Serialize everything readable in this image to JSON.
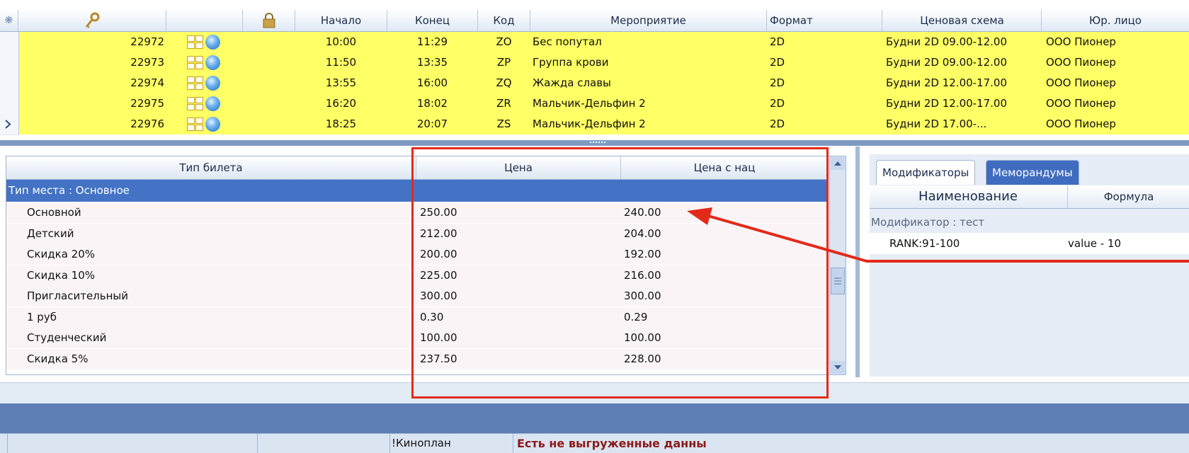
{
  "top_grid": {
    "columns": {
      "Начало": "Начало",
      "Конец": "Конец",
      "Код": "Код",
      "Мероприятие": "Мероприятие",
      "Формат": "Формат",
      "schema": "Ценовая схема",
      "legal": "Юр. лицо"
    },
    "rows": [
      {
        "id": "22972",
        "start": "10:00",
        "end": "11:29",
        "code": "ZO",
        "event": "Бес попутал",
        "format": "2D",
        "schema": "Будни 2D 09.00-12.00",
        "legal": "ООО Пионер"
      },
      {
        "id": "22973",
        "start": "11:50",
        "end": "13:35",
        "code": "ZP",
        "event": "Группа крови",
        "format": "2D",
        "schema": "Будни 2D 09.00-12.00",
        "legal": "ООО Пионер"
      },
      {
        "id": "22974",
        "start": "13:55",
        "end": "16:00",
        "code": "ZQ",
        "event": "Жажда славы",
        "format": "2D",
        "schema": "Будни 2D 12.00-17.00",
        "legal": "ООО Пионер"
      },
      {
        "id": "22975",
        "start": "16:20",
        "end": "18:02",
        "code": "ZR",
        "event": "Мальчик-Дельфин 2",
        "format": "2D",
        "schema": "Будни 2D 12.00-17.00",
        "legal": "ООО Пионер"
      },
      {
        "id": "22976",
        "start": "18:25",
        "end": "20:07",
        "code": "ZS",
        "event": "Мальчик-Дельфин 2",
        "format": "2D",
        "schema": "Будни 2D 17.00-...",
        "legal": "ООО Пионер"
      }
    ]
  },
  "ticket_panel": {
    "columns": {
      "type": "Тип билета",
      "price": "Цена",
      "price_markup": "Цена с нац"
    },
    "group_label": "Тип места : Основное",
    "rows": [
      {
        "type": "Основной",
        "price": "250.00",
        "price_markup": "240.00"
      },
      {
        "type": "Детский",
        "price": "212.00",
        "price_markup": "204.00"
      },
      {
        "type": "Скидка 20%",
        "price": "200.00",
        "price_markup": "192.00"
      },
      {
        "type": "Скидка 10%",
        "price": "225.00",
        "price_markup": "216.00"
      },
      {
        "type": "Пригласительный",
        "price": "300.00",
        "price_markup": "300.00"
      },
      {
        "type": "1 руб",
        "price": "0.30",
        "price_markup": "0.29"
      },
      {
        "type": "Студенческий",
        "price": "100.00",
        "price_markup": "100.00"
      },
      {
        "type": "Скидка 5%",
        "price": "237.50",
        "price_markup": "228.00"
      }
    ]
  },
  "right_panel": {
    "tabs": [
      "Модификаторы",
      "Меморандумы"
    ],
    "columns": {
      "name": "Наименование",
      "formula": "Формула"
    },
    "group_label": "Модификатор : тест",
    "rows": [
      {
        "name": "RANK:91-100",
        "formula": "value - 10"
      }
    ]
  },
  "status_bar": {
    "app": "!Киноплан",
    "message": "Есть не выгруженные данны"
  },
  "icons": {
    "settings": "asterisk-icon",
    "key": "key-icon",
    "lock": "lock-icon",
    "grid": "grid-icon",
    "globe": "globe-icon",
    "current_row": "row-pointer-icon"
  },
  "colors": {
    "row_highlight": "#ffff66",
    "group_row": "#4472c4",
    "annotation": "#e22a1b",
    "status_message": "#8b1a1a"
  }
}
